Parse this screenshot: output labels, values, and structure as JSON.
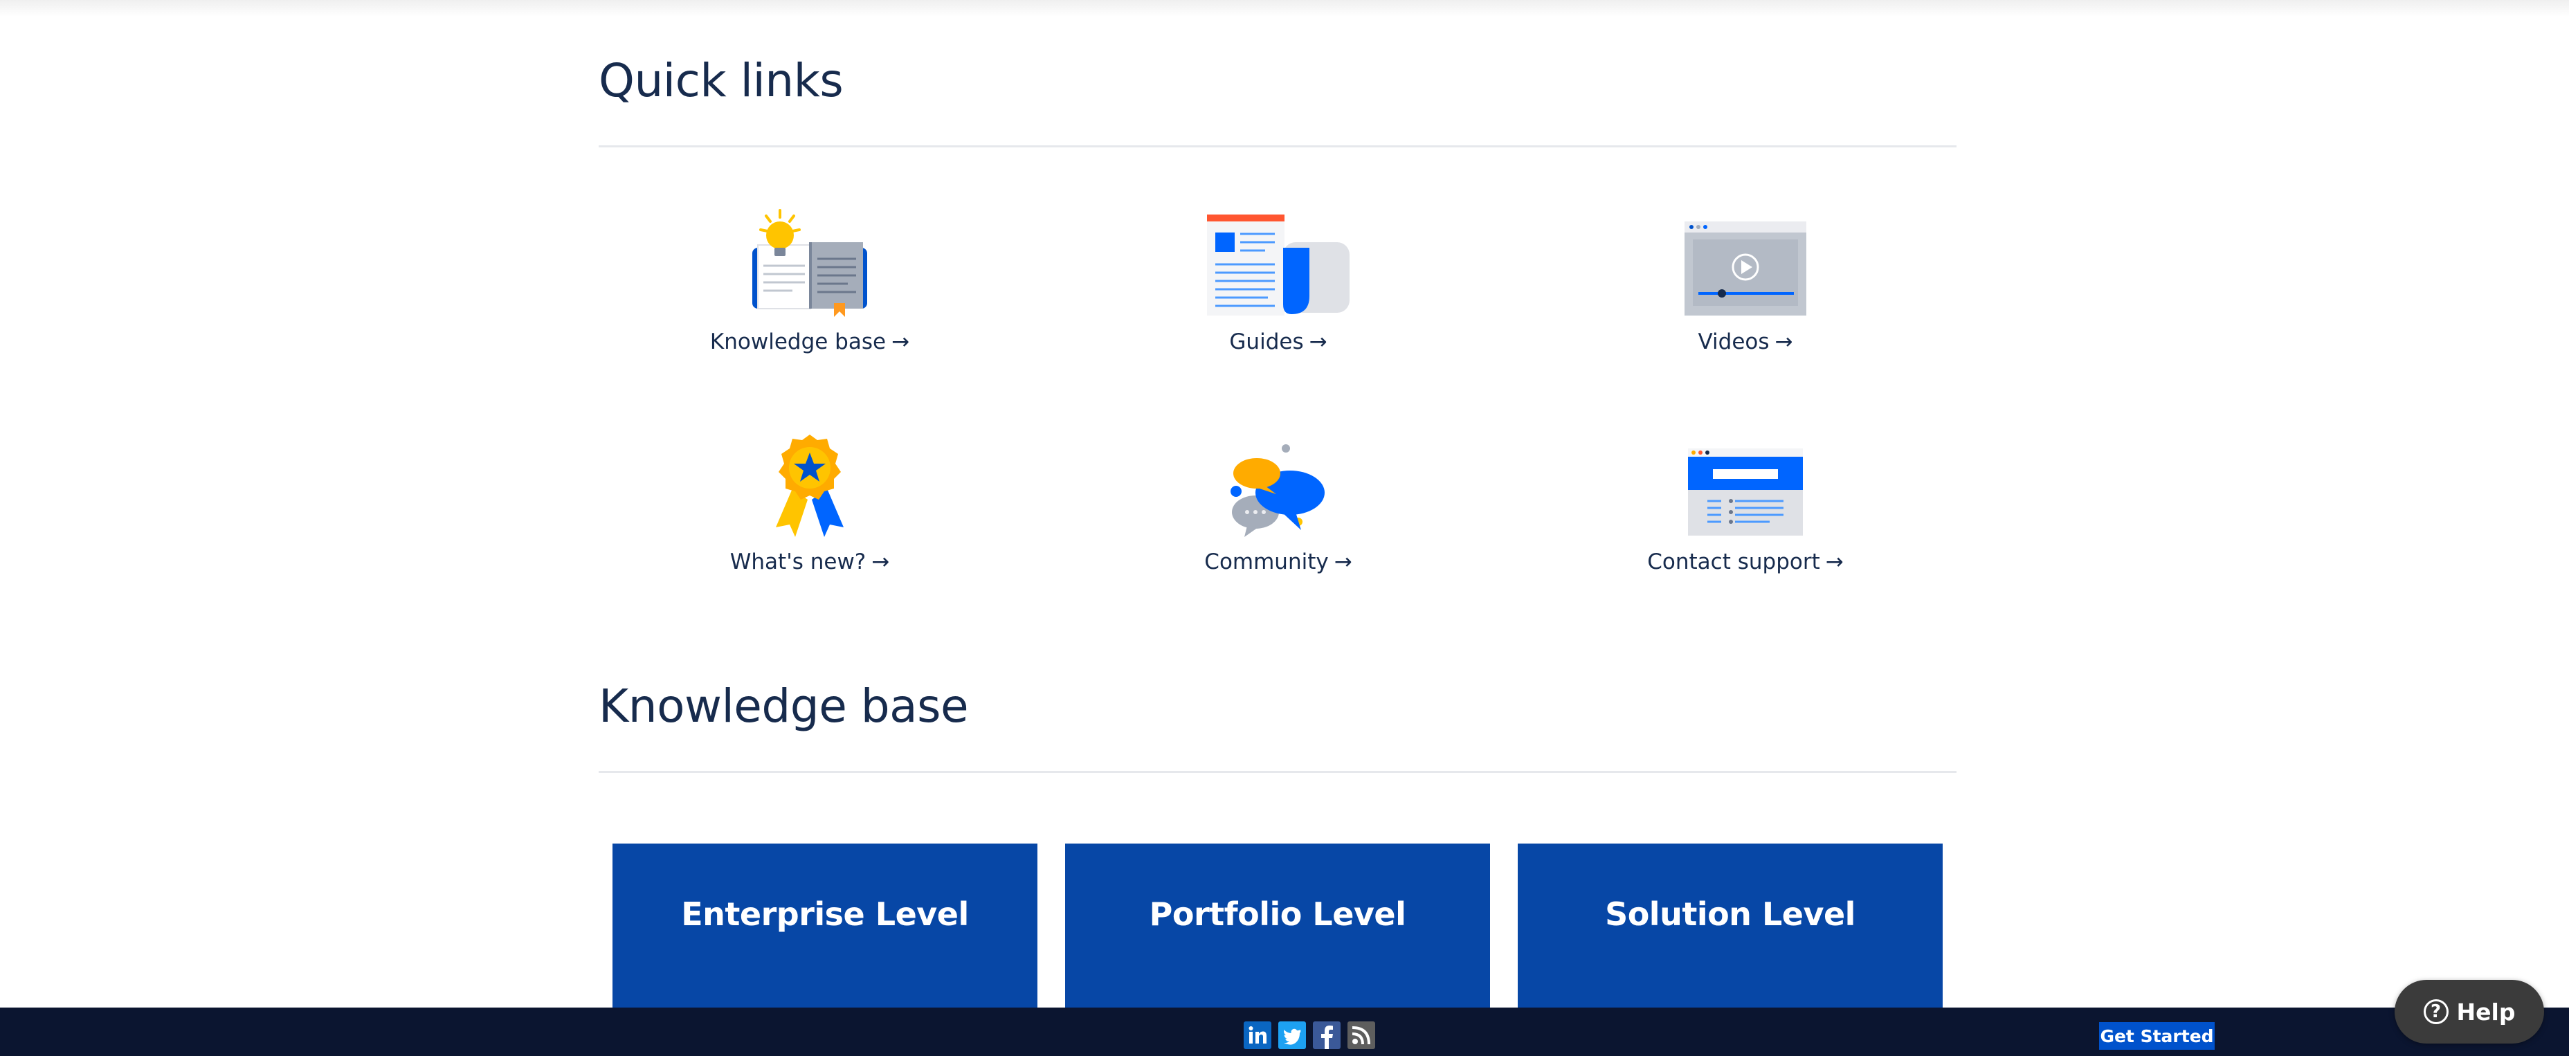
{
  "quick_links": {
    "title": "Quick links",
    "items": [
      {
        "label": "Knowledge base",
        "arrow": "→",
        "icon": "open-book-lightbulb-icon"
      },
      {
        "label": "Guides",
        "arrow": "→",
        "icon": "guide-document-icon"
      },
      {
        "label": "Videos",
        "arrow": "→",
        "icon": "video-player-icon"
      },
      {
        "label": "What's new?",
        "arrow": "→",
        "icon": "award-ribbon-icon"
      },
      {
        "label": "Community",
        "arrow": "→",
        "icon": "chat-bubbles-icon"
      },
      {
        "label": "Contact support",
        "arrow": "→",
        "icon": "support-webpage-icon"
      }
    ]
  },
  "knowledge_base": {
    "title": "Knowledge base",
    "cards": [
      {
        "label": "Enterprise Level"
      },
      {
        "label": "Portfolio Level"
      },
      {
        "label": "Solution Level"
      }
    ]
  },
  "footer": {
    "social": [
      "linkedin-icon",
      "twitter-icon",
      "facebook-icon",
      "rss-icon"
    ],
    "get_started_label": "Get Started"
  },
  "help": {
    "label": "Help",
    "icon_glyph": "?"
  },
  "colors": {
    "heading": "#172B4D",
    "card_bg": "#0747A6",
    "footer_bg": "#0b1530",
    "get_started_bg": "#0052CC",
    "help_bg": "#3b3b3b",
    "accent_blue": "#0065FF",
    "accent_yellow": "#FFC400",
    "accent_orange": "#FF991F"
  }
}
